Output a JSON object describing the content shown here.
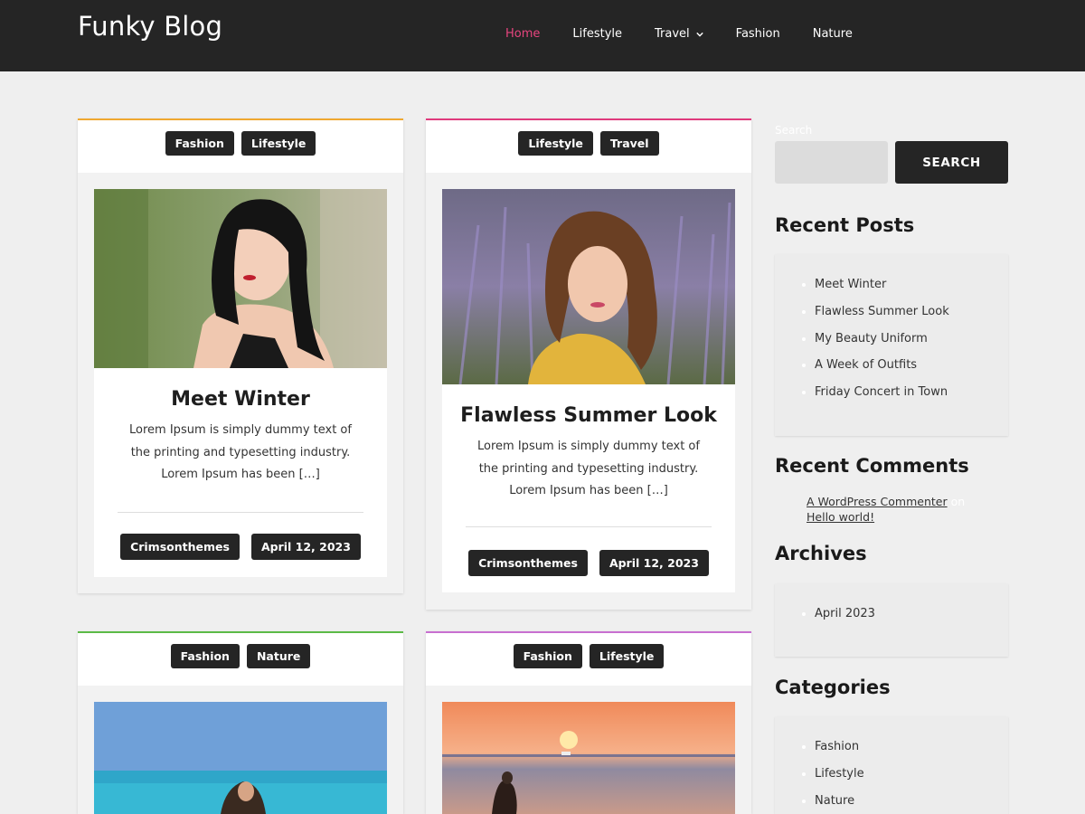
{
  "site": {
    "title": "Funky Blog"
  },
  "nav": [
    {
      "label": "Home",
      "active": true
    },
    {
      "label": "Lifestyle"
    },
    {
      "label": "Travel",
      "has_dropdown": true
    },
    {
      "label": "Fashion"
    },
    {
      "label": "Nature"
    }
  ],
  "posts": [
    {
      "accent_color": "#f0a830",
      "tags": [
        "Fashion",
        "Lifestyle"
      ],
      "title": "Meet Winter",
      "excerpt": "Lorem Ipsum is simply dummy text of the printing and typesetting industry. Lorem Ipsum has been […]",
      "author": "Crimsonthemes",
      "date": "April 12, 2023"
    },
    {
      "accent_color": "#e03a7d",
      "tags": [
        "Lifestyle",
        "Travel"
      ],
      "title": "Flawless Summer Look",
      "excerpt": "Lorem Ipsum is simply dummy text of the printing and typesetting industry. Lorem Ipsum has been […]",
      "author": "Crimsonthemes",
      "date": "April 12, 2023"
    },
    {
      "accent_color": "#5cba47",
      "tags": [
        "Fashion",
        "Nature"
      ]
    },
    {
      "accent_color": "#c86fd0",
      "tags": [
        "Fashion",
        "Lifestyle"
      ]
    }
  ],
  "sidebar": {
    "search": {
      "label": "Search",
      "button": "SEARCH",
      "placeholder": ""
    },
    "recent_posts": {
      "title": "Recent Posts",
      "items": [
        "Meet Winter",
        "Flawless Summer Look",
        "My Beauty Uniform",
        "A Week of Outfits",
        "Friday Concert in Town"
      ]
    },
    "recent_comments": {
      "title": "Recent Comments",
      "author": "A WordPress Commenter",
      "on": "on",
      "post": "Hello world!"
    },
    "archives": {
      "title": "Archives",
      "items": [
        "April 2023"
      ]
    },
    "categories": {
      "title": "Categories",
      "items": [
        "Fashion",
        "Lifestyle",
        "Nature"
      ]
    }
  }
}
